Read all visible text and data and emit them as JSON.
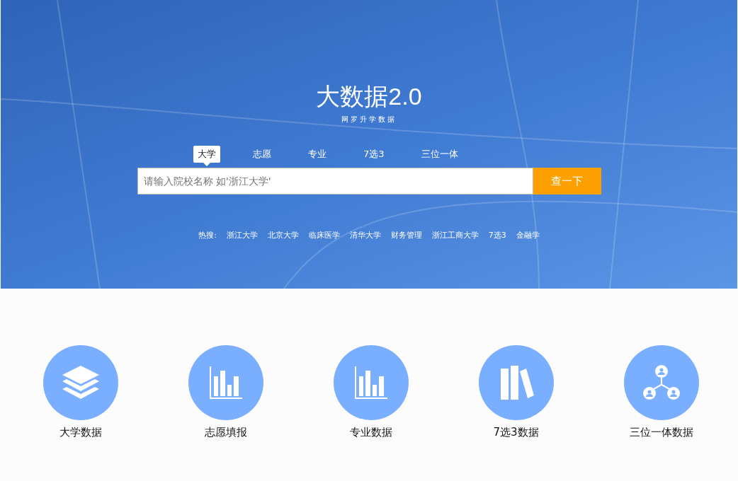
{
  "hero": {
    "title": "大数据2.0",
    "subtitle": "网罗升学数据",
    "tabs": [
      {
        "label": "大学",
        "selected": true
      },
      {
        "label": "志愿",
        "selected": false
      },
      {
        "label": "专业",
        "selected": false
      },
      {
        "label": "7选3",
        "selected": false
      },
      {
        "label": "三位一体",
        "selected": false
      }
    ],
    "search": {
      "placeholder": "请输入院校名称 如'浙江大学'",
      "button": "查一下"
    },
    "hot_label": "热搜:",
    "hot_searches": [
      "浙江大学",
      "北京大学",
      "临床医学",
      "清华大学",
      "财务管理",
      "浙江工商大学",
      "7选3",
      "金融学"
    ]
  },
  "features": [
    {
      "kind": "layers",
      "label": "大学数据"
    },
    {
      "kind": "chart",
      "label": "志愿填报"
    },
    {
      "kind": "chart",
      "label": "专业数据"
    },
    {
      "kind": "books",
      "label": "7选3数据"
    },
    {
      "kind": "network",
      "label": "三位一体数据"
    }
  ]
}
